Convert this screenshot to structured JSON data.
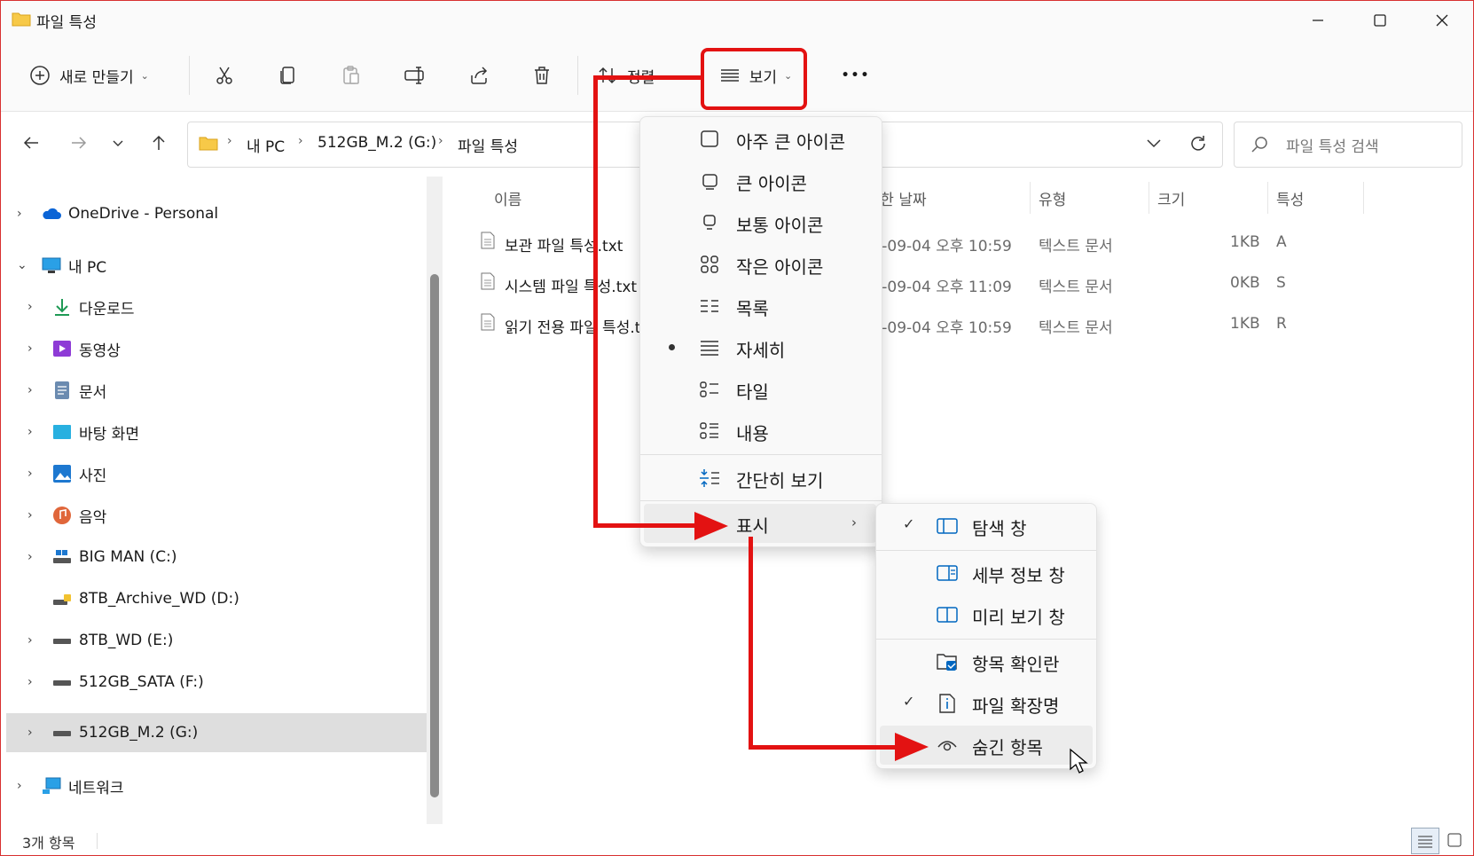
{
  "window": {
    "title": "파일 특성"
  },
  "toolbar": {
    "new_label": "새로 만들기",
    "sort_label": "정렬",
    "view_label": "보기",
    "more_label": "•••"
  },
  "address": {
    "crumbs": [
      "내 PC",
      "512GB_M.2 (G:)",
      "파일 특성"
    ],
    "search_placeholder": "파일 특성 검색"
  },
  "nav": {
    "items": [
      {
        "label": "OneDrive - Personal"
      },
      {
        "label": "내 PC"
      },
      {
        "label": "다운로드"
      },
      {
        "label": "동영상"
      },
      {
        "label": "문서"
      },
      {
        "label": "바탕 화면"
      },
      {
        "label": "사진"
      },
      {
        "label": "음악"
      },
      {
        "label": "BIG MAN (C:)"
      },
      {
        "label": "8TB_Archive_WD (D:)"
      },
      {
        "label": "8TB_WD (E:)"
      },
      {
        "label": "512GB_SATA (F:)"
      },
      {
        "label": "512GB_M.2 (G:)"
      },
      {
        "label": "네트워크"
      }
    ]
  },
  "content": {
    "columns": [
      "이름",
      "수정한 날짜",
      "유형",
      "크기",
      "특성"
    ],
    "files": [
      {
        "name": "보관 파일 특성.txt",
        "date": "2022-09-04 오후 10:59",
        "type": "텍스트 문서",
        "size": "1KB",
        "attr": "A"
      },
      {
        "name": "시스템 파일 특성.txt",
        "date": "2022-09-04 오후 11:09",
        "type": "텍스트 문서",
        "size": "0KB",
        "attr": "S"
      },
      {
        "name": "읽기 전용 파일 특성.txt",
        "date": "2022-09-04 오후 10:59",
        "type": "텍스트 문서",
        "size": "1KB",
        "attr": "R"
      }
    ]
  },
  "view_menu": {
    "items": [
      {
        "label": "아주 큰 아이콘"
      },
      {
        "label": "큰 아이콘"
      },
      {
        "label": "보통 아이콘"
      },
      {
        "label": "작은 아이콘"
      },
      {
        "label": "목록"
      },
      {
        "label": "자세히"
      },
      {
        "label": "타일"
      },
      {
        "label": "내용"
      },
      {
        "label": "간단히 보기"
      },
      {
        "label": "표시"
      }
    ],
    "selected": "자세히"
  },
  "show_menu": {
    "items": [
      {
        "label": "탐색 창",
        "checked": true
      },
      {
        "label": "세부 정보 창",
        "checked": false
      },
      {
        "label": "미리 보기 창",
        "checked": false
      },
      {
        "label": "항목 확인란",
        "checked": false
      },
      {
        "label": "파일 확장명",
        "checked": true
      },
      {
        "label": "숨긴 항목",
        "checked": false
      }
    ]
  },
  "status": {
    "count": "3개 항목"
  },
  "colors": {
    "annotation": "#e31212",
    "selected_row": "#dedede",
    "accent": "#0067c0"
  }
}
